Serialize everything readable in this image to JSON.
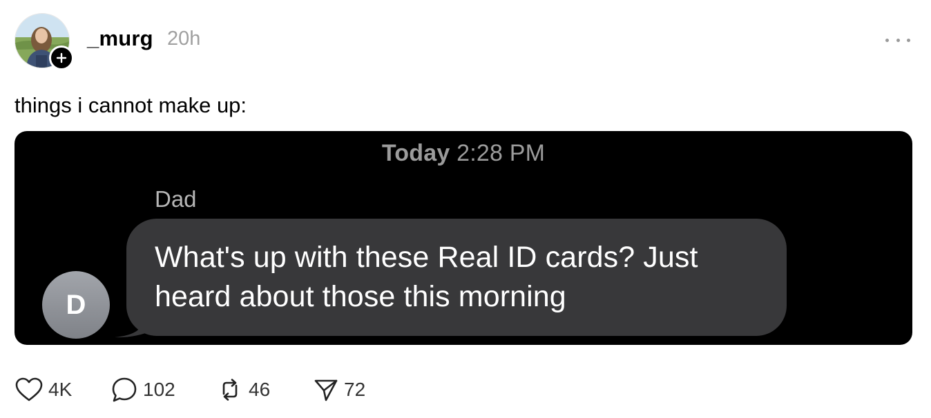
{
  "post": {
    "username": "_murg",
    "timestamp": "20h",
    "text": "things i cannot make up:"
  },
  "screenshot": {
    "time_label": "Today",
    "time_value": "2:28 PM",
    "sender": "Dad",
    "contact_initial": "D",
    "message": "What's up with these Real ID cards? Just heard about those this morning"
  },
  "actions": {
    "likes": "4K",
    "comments": "102",
    "reposts": "46",
    "shares": "72"
  },
  "icons": {
    "like": "heart-icon",
    "comment": "comment-bubble-icon",
    "repost": "repost-icon",
    "share": "send-icon",
    "more": "more-horizontal-icon",
    "follow": "plus-icon"
  },
  "colors": {
    "background": "#ffffff",
    "media_background": "#000000",
    "bubble": "#38383a",
    "muted_text": "#a0a0a0"
  }
}
